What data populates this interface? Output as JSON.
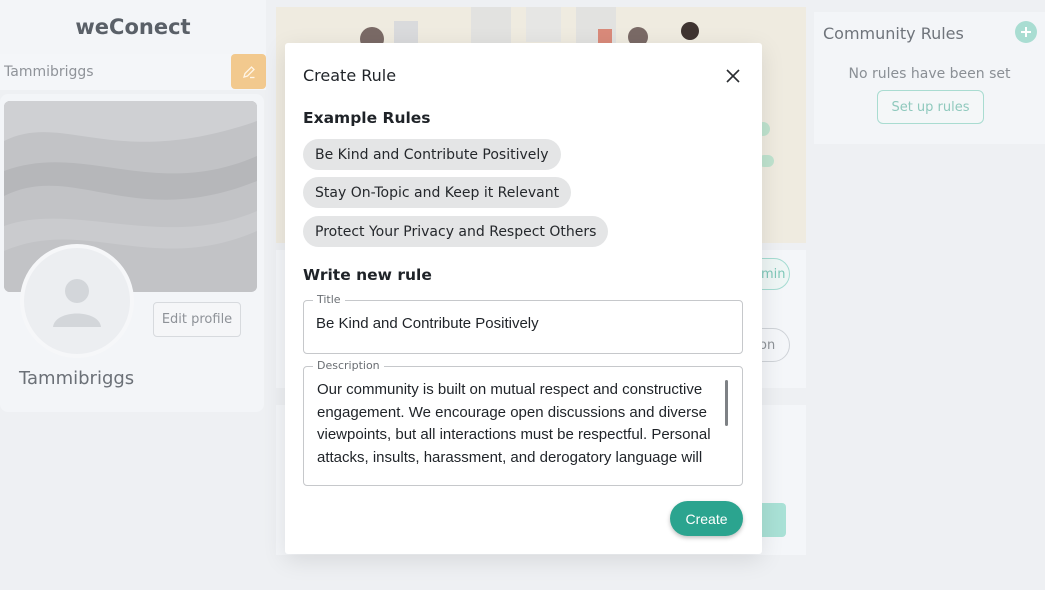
{
  "app": {
    "brand": "weConect"
  },
  "left": {
    "search_value": "Tammibriggs",
    "edit_profile_label": "Edit profile",
    "username": "Tammibriggs"
  },
  "middle": {
    "admin_fragment": "min",
    "join_fragment": "on"
  },
  "community_rules": {
    "title": "Community Rules",
    "empty_text": "No rules have been set",
    "setup_label": "Set up rules"
  },
  "modal": {
    "title": "Create Rule",
    "example_heading": "Example Rules",
    "examples": [
      "Be Kind and Contribute Positively",
      "Stay On-Topic and Keep it Relevant",
      "Protect Your Privacy and Respect Others"
    ],
    "write_heading": "Write new rule",
    "title_legend": "Title",
    "title_value": "Be Kind and Contribute Positively",
    "description_legend": "Description",
    "description_value": "Our community is built on mutual respect and constructive engagement. We encourage open discussions and diverse viewpoints, but all interactions must be respectful. Personal attacks, insults, harassment, and derogatory language will",
    "create_label": "Create"
  },
  "colors": {
    "accent": "#2ba48f",
    "chip_bg": "#e4e5e6",
    "edit_icon_bg": "#f2c98e"
  },
  "icons": {
    "close": "close-icon",
    "edit": "pencil-icon",
    "add": "plus-circle-icon",
    "avatar": "user-silhouette-icon"
  }
}
